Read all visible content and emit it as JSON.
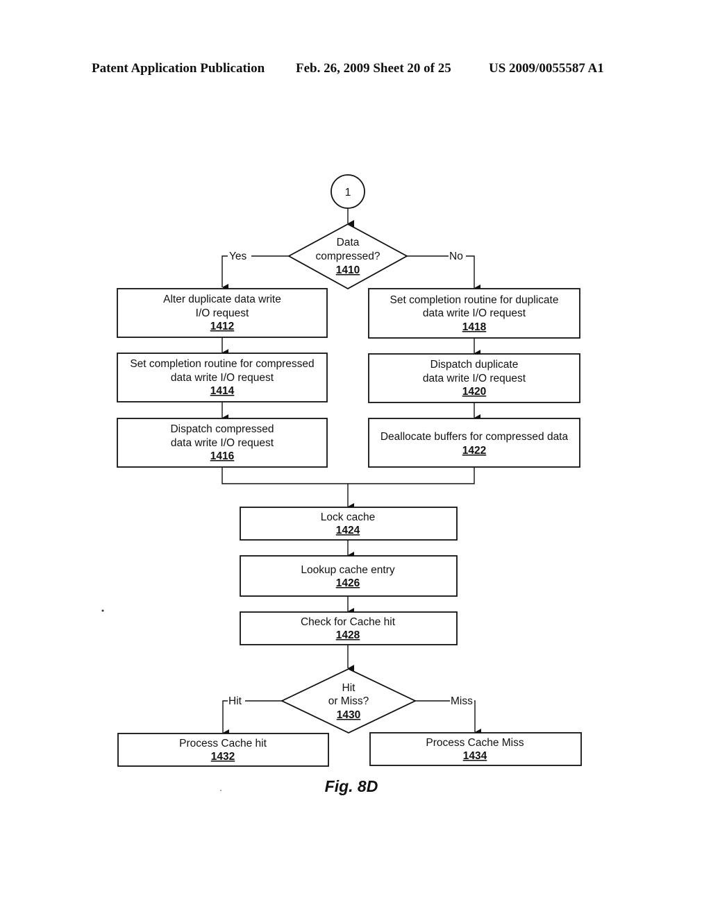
{
  "header": {
    "left": "Patent Application Publication",
    "middle": "Feb. 26, 2009   Sheet 20 of 25",
    "right": "US 2009/0055587 A1"
  },
  "connector": {
    "label": "1"
  },
  "decisions": {
    "d1410": {
      "lines": [
        "Data",
        "compressed?"
      ],
      "ref": "1410",
      "yes_label": "Yes",
      "no_label": "No"
    },
    "d1430": {
      "lines": [
        "Hit",
        "or Miss?"
      ],
      "ref": "1430",
      "hit_label": "Hit",
      "miss_label": "Miss"
    }
  },
  "boxes": {
    "b1412": {
      "lines": [
        "Alter duplicate data write",
        "I/O request"
      ],
      "ref": "1412"
    },
    "b1414": {
      "lines": [
        "Set completion routine for compressed",
        "data write  I/O request"
      ],
      "ref": "1414"
    },
    "b1416": {
      "lines": [
        "Dispatch compressed",
        "data write I/O request"
      ],
      "ref": "1416"
    },
    "b1418": {
      "lines": [
        "Set completion routine for duplicate",
        "data write I/O request"
      ],
      "ref": "1418"
    },
    "b1420": {
      "lines": [
        "Dispatch duplicate",
        "data write I/O request"
      ],
      "ref": "1420"
    },
    "b1422": {
      "lines": [
        "Deallocate buffers for compressed data"
      ],
      "ref": "1422"
    },
    "b1424": {
      "lines": [
        "Lock  cache"
      ],
      "ref": "1424"
    },
    "b1426": {
      "lines": [
        "Lookup cache entry"
      ],
      "ref": "1426"
    },
    "b1428": {
      "lines": [
        "Check for Cache hit"
      ],
      "ref": "1428"
    },
    "b1432": {
      "lines": [
        "Process Cache hit"
      ],
      "ref": "1432"
    },
    "b1434": {
      "lines": [
        "Process Cache Miss"
      ],
      "ref": "1434"
    }
  },
  "figure_caption": "Fig. 8D"
}
